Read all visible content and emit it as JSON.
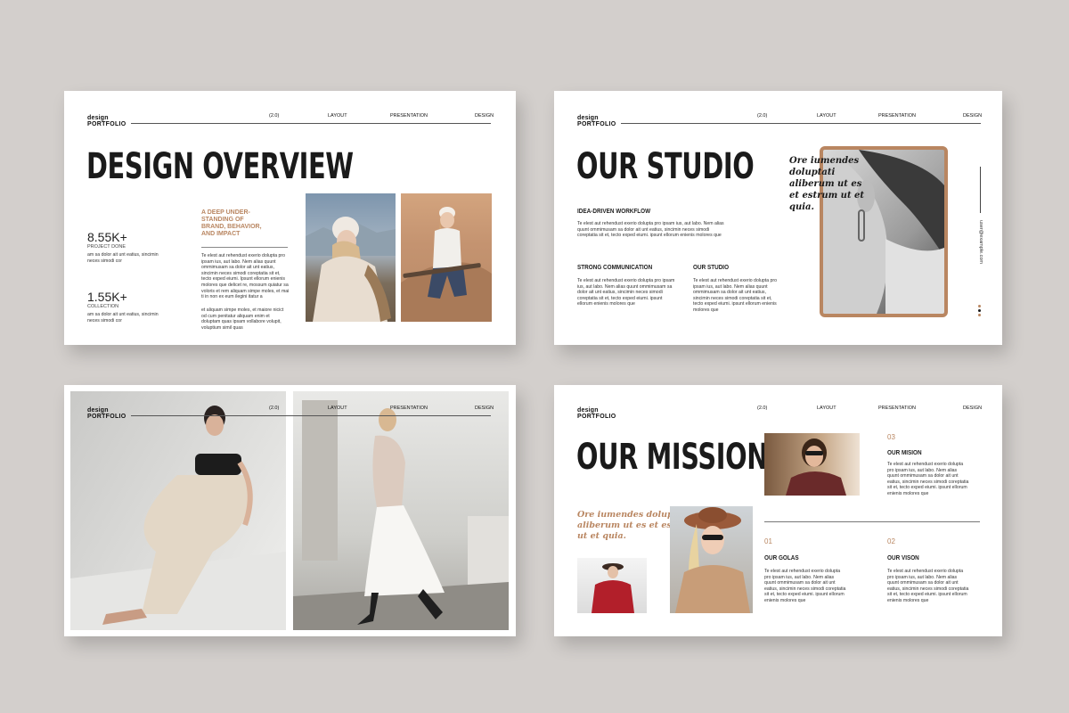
{
  "colors": {
    "accent": "#b98661",
    "background": "#d3cfcc",
    "slide": "#ffffff",
    "heading": "#1a1a1a"
  },
  "brand": {
    "line1": "design",
    "line2": "PORTFOLIO"
  },
  "nav": {
    "version": "(2.0)",
    "layout": "LAYOUT",
    "presentation": "PRESENTATION",
    "design": "DESIGN"
  },
  "slide1": {
    "title": "DESIGN OVERVIEW",
    "stat1_value": "8.55K+",
    "stat1_label": "PROJECT DONE",
    "stat1_desc": "am sa dolor ait unt eatius, sincimin neces simodi cor",
    "stat2_value": "1.55K+",
    "stat2_label": "COLLECTION",
    "stat2_desc": "am sa dolor ait unt eatius, sincimin neces simodi cor",
    "accent_heading": "A DEEP UNDER-\nSTANDING OF\nBRAND, BEHAVIOR,\nAND IMPACT",
    "para1": "Te elest aut rehendust exerio dolupta pro ipsam ius, aut labo. Nem alias quunt ommimusam sa dolor ait unt eatius, sincimin neces simodi coreptatia sit et, tecto exped eiumi. Ipsunt ellorum enienis molores que delicet re, mossum quiatur sa voloris et rem aliquam simpe moles, et mai ti in non ex eum ilegini itatur a",
    "para2": "et aliquam simpe moles, et maiore nicict od cum penitatur aliquam enim et doluptam quas ipsam vollabore volupit, voluptium simil quas"
  },
  "slide2": {
    "title": "OUR STUDIO",
    "section1": "IDEA-DRIVEN WORKFLOW",
    "section2": "STRONG COMMUNICATION",
    "section3": "OUR STUDIO",
    "para": "Te elest aut rehendust exerio dolupta pro ipsam ius, aut labo. Nem alias quunt ommimusam sa dolor ait unt eatius, sincimin neces simodi coreptatia sit et, tecto exped eiumi. ipsunt ellorum enienis molores que",
    "quote": "Ore iumendes doluptati aliberum ut es et estrum ut et quia.",
    "email": "user@example.com"
  },
  "slide4": {
    "title": "OUR MISSION",
    "quote": "Ore iumendes doluptati aliberum ut es et estrum ut et quia.",
    "n1": "01",
    "h1": "OUR GOLAS",
    "n2": "02",
    "h2": "OUR VISON",
    "n3": "03",
    "h3": "OUR MISION",
    "para": "Te elest aut rehendust exerio dolupta pro ipsam ius, aut labo. Nem alias quunt ommimusam sa dolor ait unt eatius, sincimin neces simodi coreptatia sit et, tecto exped eiumi. ipsunt ellorum enienis molores que"
  }
}
